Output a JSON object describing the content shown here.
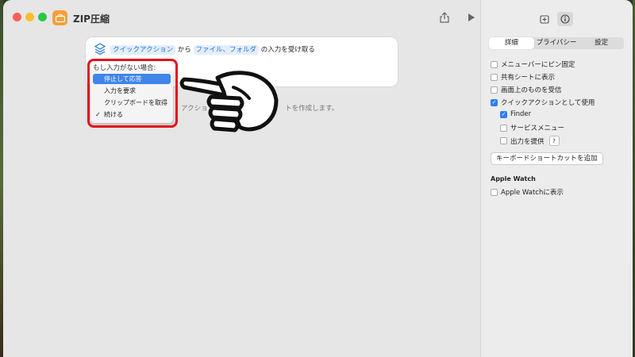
{
  "window": {
    "title": "ZIP圧縮"
  },
  "action_card": {
    "token1": "クイックアクション",
    "word_kara": "から",
    "token2": "ファイル、フォルダ",
    "suffix": "の入力を受け取る"
  },
  "no_input": {
    "label": "もし入力がない場合:",
    "options": [
      "停止して応答",
      "入力を要求",
      "クリップボードを取得",
      "続ける"
    ],
    "selected_index": 0,
    "checked_index": 3
  },
  "helper": {
    "left": "アクション",
    "right": "トを作成します。"
  },
  "inspector": {
    "tabs": [
      "詳細",
      "プライバシー",
      "設定"
    ],
    "active_tab": 0,
    "options": [
      {
        "label": "メニューバーにピン固定",
        "checked": false
      },
      {
        "label": "共有シートに表示",
        "checked": false
      },
      {
        "label": "画面上のものを受信",
        "checked": false
      },
      {
        "label": "クイックアクションとして使用",
        "checked": true
      }
    ],
    "sub_options": [
      {
        "label": "Finder",
        "checked": true
      },
      {
        "label": "サービスメニュー",
        "checked": false
      },
      {
        "label": "出力を提供",
        "checked": false
      }
    ],
    "help_label": "?",
    "keyboard_button": "キーボードショートカットを追加",
    "apple_watch_header": "Apple Watch",
    "apple_watch_option": {
      "label": "Apple Watchに表示",
      "checked": false
    }
  },
  "colors": {
    "highlight_frame": "#e4101b",
    "selection": "#3f85ea",
    "accent": "#2f7ff0"
  }
}
